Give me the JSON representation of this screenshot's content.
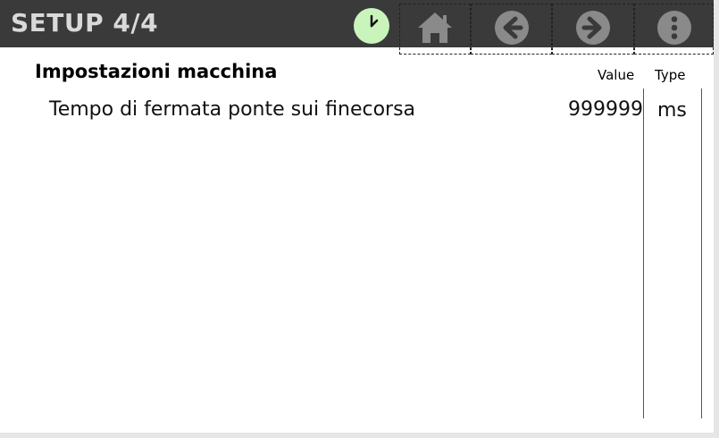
{
  "header": {
    "title": "SETUP 4/4",
    "icons": {
      "timer": "clock-icon",
      "home": "home-icon",
      "back": "arrow-left-icon",
      "forward": "arrow-right-icon",
      "menu": "more-vertical-icon"
    },
    "colors": {
      "bar": "#3a3a3a",
      "title": "#d9d9d9",
      "timer_bg": "#c9f5bd",
      "icon": "#8a8a8a"
    }
  },
  "section": {
    "title": "Impostazioni macchina"
  },
  "columns": {
    "value": "Value",
    "type": "Type"
  },
  "parameters": [
    {
      "label": "Tempo di fermata ponte sui finecorsa",
      "value": "999999",
      "unit": "ms"
    }
  ]
}
